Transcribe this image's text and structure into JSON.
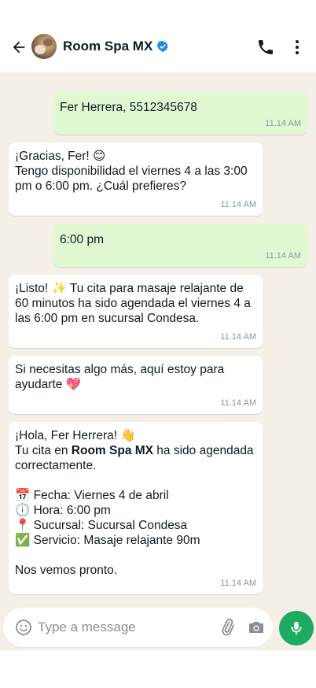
{
  "header": {
    "chat_name": "Room Spa MX",
    "icons": [
      "back-arrow-icon",
      "verified-badge-icon",
      "phone-icon",
      "more-vertical-icon"
    ],
    "verified_color": "#1e88e5"
  },
  "messages": [
    {
      "direction": "outgoing",
      "text": "Fer Herrera, 5512345678",
      "time": "11.14 AM"
    },
    {
      "direction": "incoming",
      "text": "¡Gracias, Fer! 😊\nTengo disponibilidad el viernes 4 a las 3:00 pm o 6:00 pm. ¿Cuál prefieres?",
      "time": "11.14 AM"
    },
    {
      "direction": "outgoing",
      "text": "6:00 pm",
      "time": "11.14 AM"
    },
    {
      "direction": "incoming",
      "text": "¡Listo! ✨ Tu cita para masaje relajante de 60 minutos ha sido agendada el viernes 4 a las 6:00 pm en sucursal Condesa.",
      "time": "11.14 AM"
    },
    {
      "direction": "incoming",
      "text": "Si necesitas algo más, aquí estoy para ayudarte 💖",
      "time": "11.14 AM"
    },
    {
      "direction": "incoming",
      "greeting": "¡Hola, Fer Herrera! 👋",
      "intro_before": "Tu cita en ",
      "intro_bold": "Room Spa MX",
      "intro_after": " ha sido agendada correctamente.",
      "details": [
        "📅 Fecha: Viernes 4 de abril",
        "🕕 Hora: 6:00 pm",
        "📍 Sucursal: Sucursal Condesa",
        "✅ Servicio: Masaje relajante 90m"
      ],
      "closing": "Nos vemos pronto.",
      "time": "11.14 AM"
    }
  ],
  "composer": {
    "placeholder": "Type a message",
    "icons": [
      "emoji-icon",
      "paperclip-icon",
      "camera-icon",
      "microphone-icon"
    ],
    "mic_button_color": "#1daa61"
  },
  "colors": {
    "chat_background": "#f4efe7",
    "outgoing_bubble": "#e0f9d3",
    "incoming_bubble": "#ffffff",
    "timestamp": "#8696a0"
  }
}
